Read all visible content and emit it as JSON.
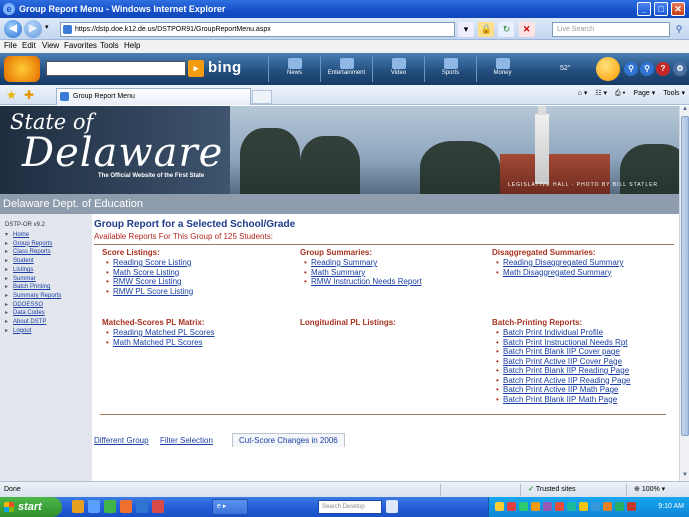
{
  "window": {
    "title": "Group Report Menu - Windows Internet Explorer"
  },
  "address_bar": {
    "url": "https://dstp.doe.k12.de.us/DSTPOR91/GroupReportMenu.aspx",
    "search_placeholder": "Live Search"
  },
  "menu": {
    "items": [
      "File",
      "Edit",
      "View",
      "Favorites",
      "Tools",
      "Help"
    ]
  },
  "bing_toolbar": {
    "logo_text": "bing",
    "tabs": [
      "News",
      "Entertainment",
      "Video",
      "Sports",
      "Money"
    ],
    "weather": "52°"
  },
  "tab_bar": {
    "active_tab": "Group Report Menu",
    "tools": [
      "Page ▾",
      "Tools ▾"
    ]
  },
  "banner": {
    "state_of": "State of",
    "delaware": "Delaware",
    "official": "The Official Website of the First State",
    "credit": "LEGISLATIVE HALL · PHOTO BY BILL STATLER"
  },
  "dept_bar": "Delaware Dept. of Education",
  "sidebar": {
    "version": "DSTP-OR v9.2",
    "items": [
      {
        "marker": "▾",
        "label": "Home"
      },
      {
        "marker": "▸",
        "label": "Group Reports"
      },
      {
        "marker": "▸",
        "label": "Class Reports"
      },
      {
        "marker": "▸",
        "label": "Student"
      },
      {
        "marker": "▸",
        "label": "Listings"
      },
      {
        "marker": "▸",
        "label": "Summar"
      },
      {
        "marker": "▸",
        "label": "Batch Printing"
      },
      {
        "marker": "▸",
        "label": "Summary Reports"
      },
      {
        "marker": "▸",
        "label": "DDOESSO"
      },
      {
        "marker": "▸",
        "label": "Data Codes"
      },
      {
        "marker": "▸",
        "label": "About DSTP"
      },
      {
        "marker": "▸",
        "label": "Logout"
      }
    ]
  },
  "main": {
    "heading": "Group Report for a Selected School/Grade",
    "available": "Available Reports For This Group of 125 Students:",
    "sections": {
      "score_listings": {
        "title": "Score Listings:",
        "links": [
          "Reading Score Listing",
          "Math Score Listing",
          "RMW Score Listing",
          "RMW PL Score Listing"
        ]
      },
      "group_summaries": {
        "title": "Group Summaries:",
        "links": [
          "Reading Summary",
          "Math Summary",
          "RMW Instruction Needs Report"
        ]
      },
      "disaggregated": {
        "title": "Disaggregated Summaries:",
        "links": [
          "Reading Disaggregated Summary",
          "Math Disaggregated Summary"
        ]
      },
      "matched": {
        "title": "Matched-Scores PL Matrix:",
        "links": [
          "Reading Matched PL Scores",
          "Math Matched PL Scores"
        ]
      },
      "longitudinal": {
        "title": "Longitudinal PL Listings:",
        "links": []
      },
      "batch": {
        "title": "Batch-Printing Reports:",
        "links": [
          "Batch Print Individual Profile",
          "Batch Print Instructional Needs Rpt",
          "Batch Print Blank IIP Cover page",
          "Batch Print Active IIP Cover Page",
          "Batch Print Blank IIP Reading Page",
          "Batch Print Active IIP Reading Page",
          "Batch Print Active IIP Math Page",
          "Batch Print Blank IIP Math Page"
        ]
      }
    },
    "bottom": {
      "different_group": "Different Group",
      "filter_selection": "Filter Selection",
      "cut_score": "Cut-Score Changes in 2006"
    }
  },
  "status_bar": {
    "text": "Done",
    "zone": "Trusted sites",
    "zoom": "100%"
  },
  "taskbar": {
    "start": "start",
    "search_placeholder": "Search Desktop",
    "clock": "9:10 AM"
  }
}
